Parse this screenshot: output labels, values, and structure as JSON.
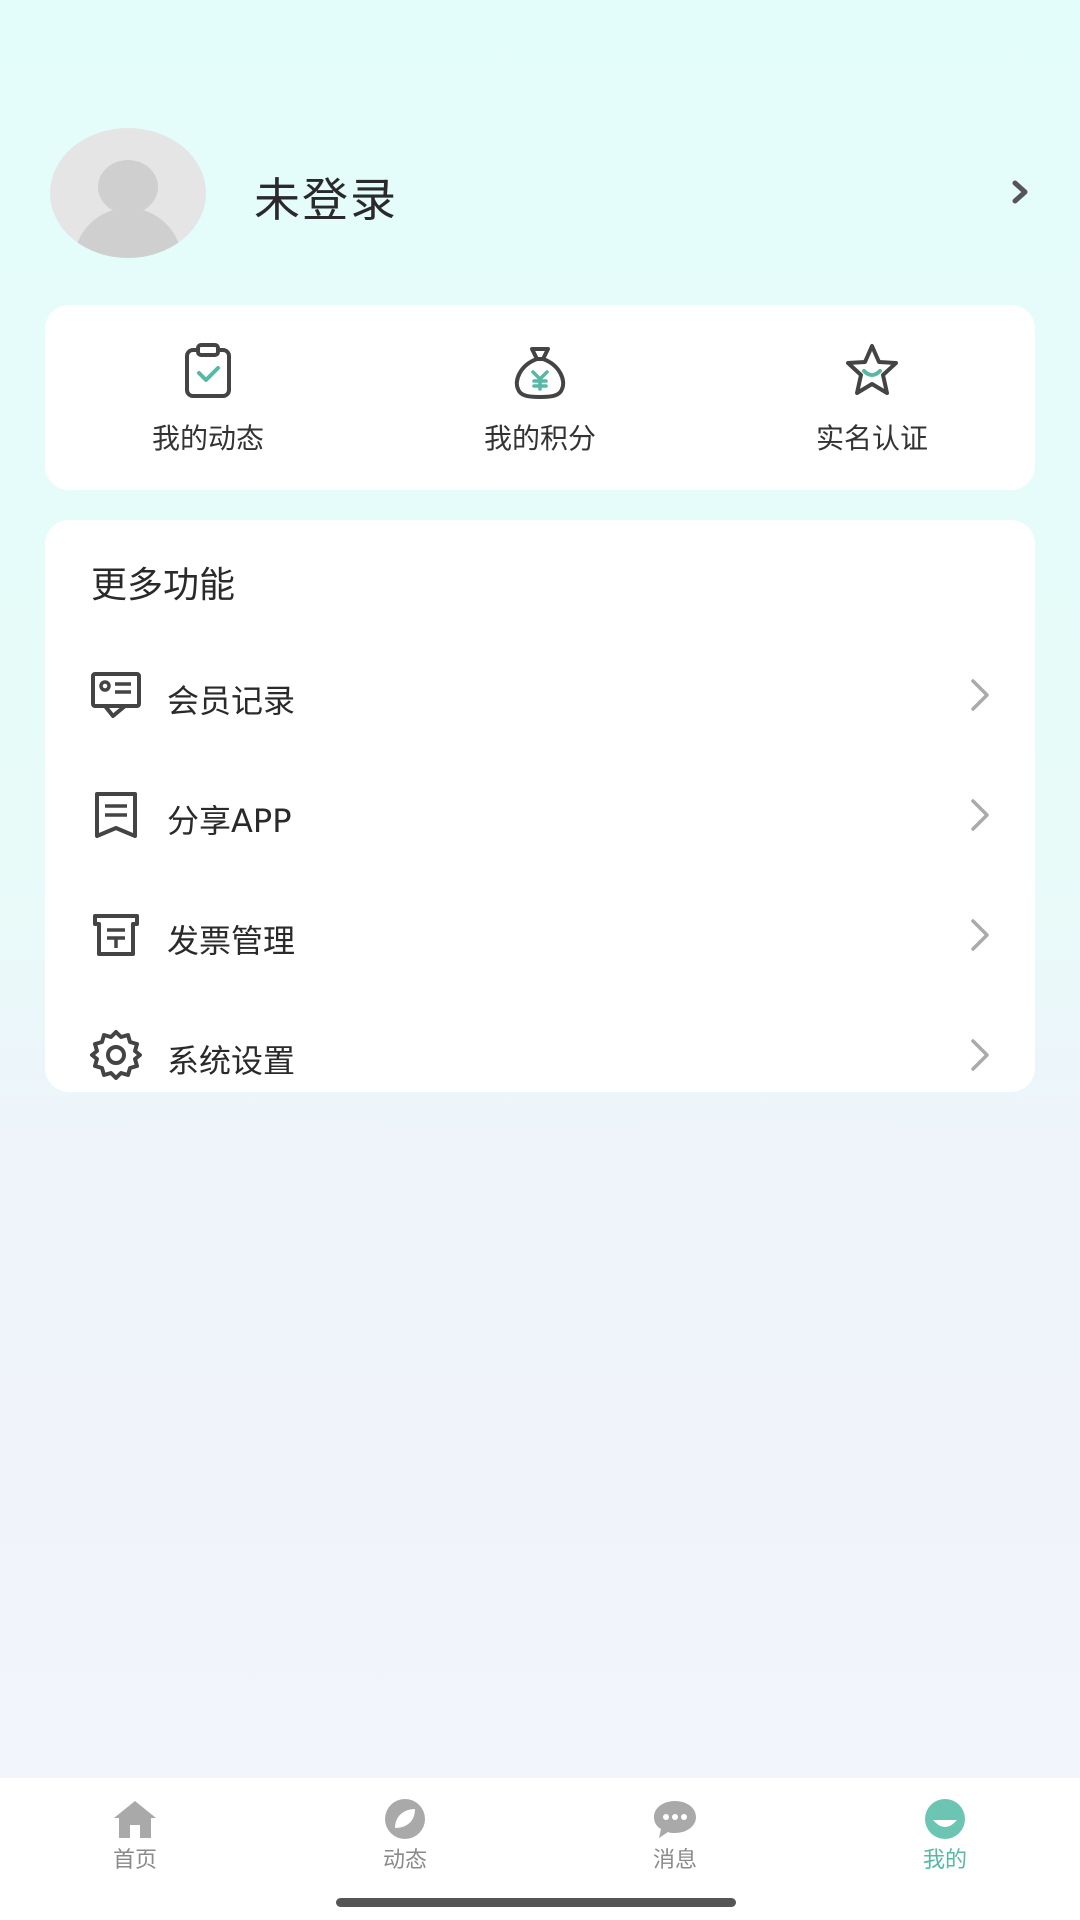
{
  "profile": {
    "username": "未登录",
    "avatar_icon": "avatar-placeholder-icon",
    "chevron_icon": "chevron-right-icon"
  },
  "quick_actions": [
    {
      "label": "我的动态",
      "icon": "clipboard-check-icon"
    },
    {
      "label": "我的积分",
      "icon": "money-bag-yen-icon"
    },
    {
      "label": "实名认证",
      "icon": "star-badge-icon"
    }
  ],
  "more": {
    "title": "更多功能",
    "items": [
      {
        "label": "会员记录",
        "icon": "member-record-icon"
      },
      {
        "label": "分享APP",
        "icon": "share-document-icon"
      },
      {
        "label": "发票管理",
        "icon": "invoice-icon"
      },
      {
        "label": "系统设置",
        "icon": "gear-icon"
      }
    ]
  },
  "tabs": [
    {
      "label": "首页",
      "icon": "home-icon",
      "active": false
    },
    {
      "label": "动态",
      "icon": "leaf-icon",
      "active": false
    },
    {
      "label": "消息",
      "icon": "chat-bubble-icon",
      "active": false
    },
    {
      "label": "我的",
      "icon": "face-icon",
      "active": true
    }
  ],
  "colors": {
    "accent": "#55b9a5",
    "text": "#2a2a2a",
    "icon_dark": "#444444",
    "inactive": "#8a8a8a"
  }
}
